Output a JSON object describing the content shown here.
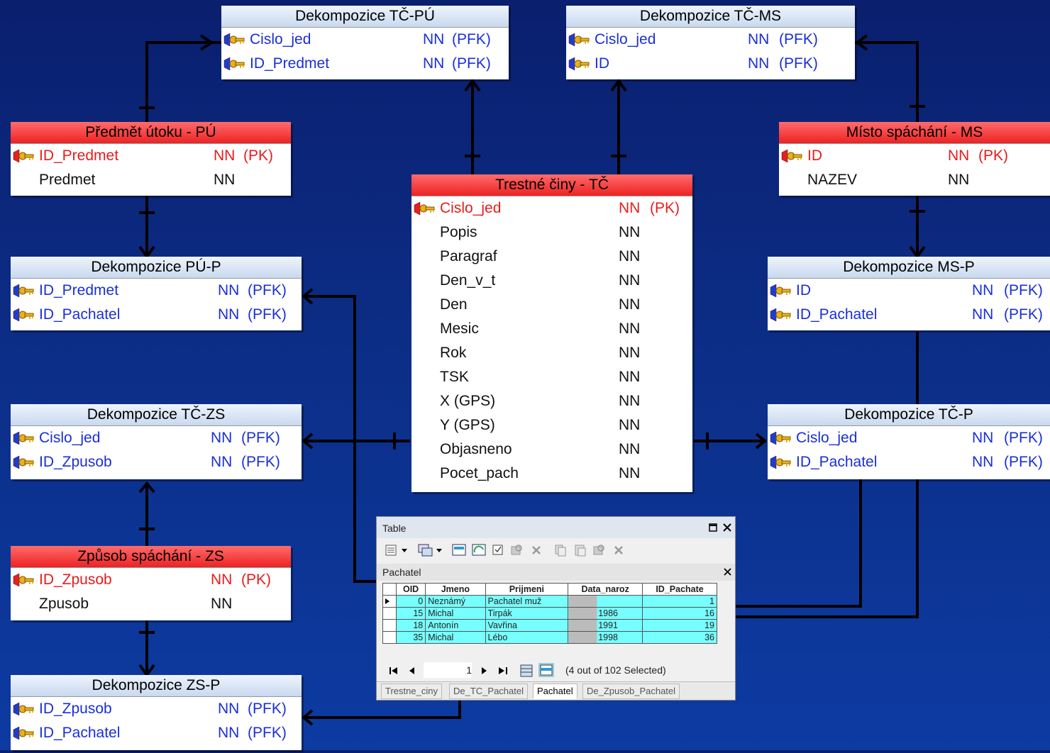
{
  "entities": {
    "tc_pu": {
      "title": "Dekompozice TČ-PÚ",
      "rows": [
        {
          "name": "Cislo_jed",
          "nn": "NN",
          "type": "(PFK)"
        },
        {
          "name": "ID_Predmet",
          "nn": "NN",
          "type": "(PFK)"
        }
      ]
    },
    "tc_ms": {
      "title": "Dekompozice TČ-MS",
      "rows": [
        {
          "name": "Cislo_jed",
          "nn": "NN",
          "type": "(PFK)"
        },
        {
          "name": "ID",
          "nn": "NN",
          "type": "(PFK)"
        }
      ]
    },
    "pu": {
      "title": "Předmět útoku - PÚ",
      "rows": [
        {
          "name": "ID_Predmet",
          "nn": "NN",
          "type": "(PK)"
        },
        {
          "name": "Predmet",
          "nn": "NN",
          "type": ""
        }
      ]
    },
    "ms": {
      "title": "Místo spáchání - MS",
      "rows": [
        {
          "name": "ID",
          "nn": "NN",
          "type": "(PK)"
        },
        {
          "name": "NAZEV",
          "nn": "NN",
          "type": ""
        }
      ]
    },
    "tc": {
      "title": "Trestné činy - TČ",
      "rows": [
        {
          "name": "Cislo_jed",
          "nn": "NN",
          "type": "(PK)"
        },
        {
          "name": "Popis",
          "nn": "NN",
          "type": ""
        },
        {
          "name": "Paragraf",
          "nn": "NN",
          "type": ""
        },
        {
          "name": "Den_v_t",
          "nn": "NN",
          "type": ""
        },
        {
          "name": "Den",
          "nn": "NN",
          "type": ""
        },
        {
          "name": "Mesic",
          "nn": "NN",
          "type": ""
        },
        {
          "name": "Rok",
          "nn": "NN",
          "type": ""
        },
        {
          "name": "TSK",
          "nn": "NN",
          "type": ""
        },
        {
          "name": "X (GPS)",
          "nn": "NN",
          "type": ""
        },
        {
          "name": "Y (GPS)",
          "nn": "NN",
          "type": ""
        },
        {
          "name": "Objasneno",
          "nn": "NN",
          "type": ""
        },
        {
          "name": "Pocet_pach",
          "nn": "NN",
          "type": ""
        }
      ]
    },
    "pu_p": {
      "title": "Dekompozice PÚ-P",
      "rows": [
        {
          "name": "ID_Predmet",
          "nn": "NN",
          "type": "(PFK)"
        },
        {
          "name": "ID_Pachatel",
          "nn": "NN",
          "type": "(PFK)"
        }
      ]
    },
    "ms_p": {
      "title": "Dekompozice MS-P",
      "rows": [
        {
          "name": "ID",
          "nn": "NN",
          "type": "(PFK)"
        },
        {
          "name": "ID_Pachatel",
          "nn": "NN",
          "type": "(PFK)"
        }
      ]
    },
    "tc_zs": {
      "title": "Dekompozice TČ-ZS",
      "rows": [
        {
          "name": "Cislo_jed",
          "nn": "NN",
          "type": "(PFK)"
        },
        {
          "name": "ID_Zpusob",
          "nn": "NN",
          "type": "(PFK)"
        }
      ]
    },
    "tc_p": {
      "title": "Dekompozice TČ-P",
      "rows": [
        {
          "name": "Cislo_jed",
          "nn": "NN",
          "type": "(PFK)"
        },
        {
          "name": "ID_Pachatel",
          "nn": "NN",
          "type": "(PFK)"
        }
      ]
    },
    "zs": {
      "title": "Způsob spáchání - ZS",
      "rows": [
        {
          "name": "ID_Zpusob",
          "nn": "NN",
          "type": "(PK)"
        },
        {
          "name": "Zpusob",
          "nn": "NN",
          "type": ""
        }
      ]
    },
    "zs_p": {
      "title": "Dekompozice ZS-P",
      "rows": [
        {
          "name": "ID_Zpusob",
          "nn": "NN",
          "type": "(PFK)"
        },
        {
          "name": "ID_Pachatel",
          "nn": "NN",
          "type": "(PFK)"
        }
      ]
    }
  },
  "table_window": {
    "title": "Table",
    "subtitle": "Pachatel",
    "columns": [
      "OID",
      "Jmeno",
      "Prijmeni",
      "Data_naroz",
      "ID_Pachate"
    ],
    "rows": [
      {
        "oid": "0",
        "jmeno": "Neznámý",
        "prijmeni": "Pachatel muž",
        "data": "",
        "id": "1"
      },
      {
        "oid": "15",
        "jmeno": "Michal",
        "prijmeni": "Tirpák",
        "data": "1986",
        "id": "16"
      },
      {
        "oid": "18",
        "jmeno": "Antonín",
        "prijmeni": "Vavřina",
        "data": "1991",
        "id": "19"
      },
      {
        "oid": "35",
        "jmeno": "Michal",
        "prijmeni": "Lébo",
        "data": "1998",
        "id": "36"
      }
    ],
    "record_number": "1",
    "selection_text": "(4 out of 102 Selected)",
    "tabs": [
      "Trestne_ciny",
      "De_TC_Pachatel",
      "Pachatel",
      "De_Zpusob_Pachatel"
    ],
    "active_tab": "Pachatel"
  },
  "colors": {
    "pk_text": "#e81c1c",
    "fk_text": "#1a2fd6",
    "table_cell": "#77ffff"
  }
}
